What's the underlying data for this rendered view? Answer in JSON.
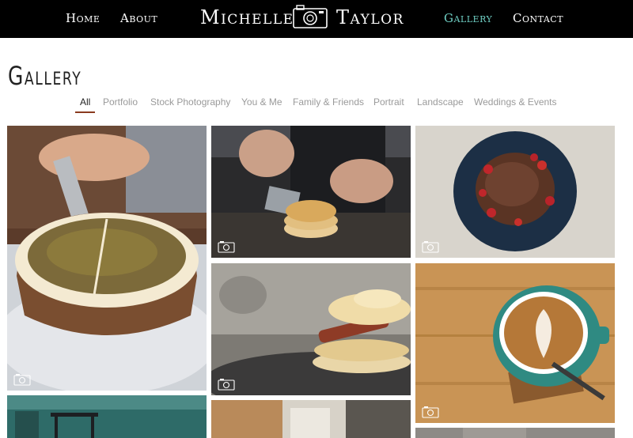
{
  "nav": {
    "home": "Home",
    "about": "About",
    "gallery": "Gallery",
    "contact": "Contact",
    "active": "gallery"
  },
  "brand": {
    "first_name": "Michelle",
    "last_name": "Taylor",
    "logo_icon": "camera-icon"
  },
  "page": {
    "title": "Gallery"
  },
  "filters": {
    "items": [
      "All",
      "Portfolio",
      "Stock Photography",
      "You & Me",
      "Family & Friends",
      "Portrait",
      "Landscape",
      "Weddings & Events"
    ],
    "selected": "All"
  },
  "gallery": {
    "items": [
      {
        "subject": "cake-slicing",
        "badge_icon": "camera-icon"
      },
      {
        "subject": "pancake-stack-pour",
        "badge_icon": "camera-icon"
      },
      {
        "subject": "chocolate-pancake-strawberries",
        "badge_icon": "camera-icon"
      },
      {
        "subject": "pancakes-with-bacon",
        "badge_icon": "camera-icon"
      },
      {
        "subject": "latte-art-cup",
        "badge_icon": "camera-icon"
      },
      {
        "subject": "cafe-chairs-teal",
        "badge_icon": "camera-icon"
      },
      {
        "subject": "cafe-interior",
        "badge_icon": "camera-icon"
      },
      {
        "subject": "grey-texture",
        "badge_icon": "camera-icon"
      }
    ]
  },
  "colors": {
    "header_bg": "#000000",
    "nav_active": "#6fcfc4",
    "filter_active_underline": "#8a3b1f",
    "filter_inactive": "#9a9a9a"
  }
}
